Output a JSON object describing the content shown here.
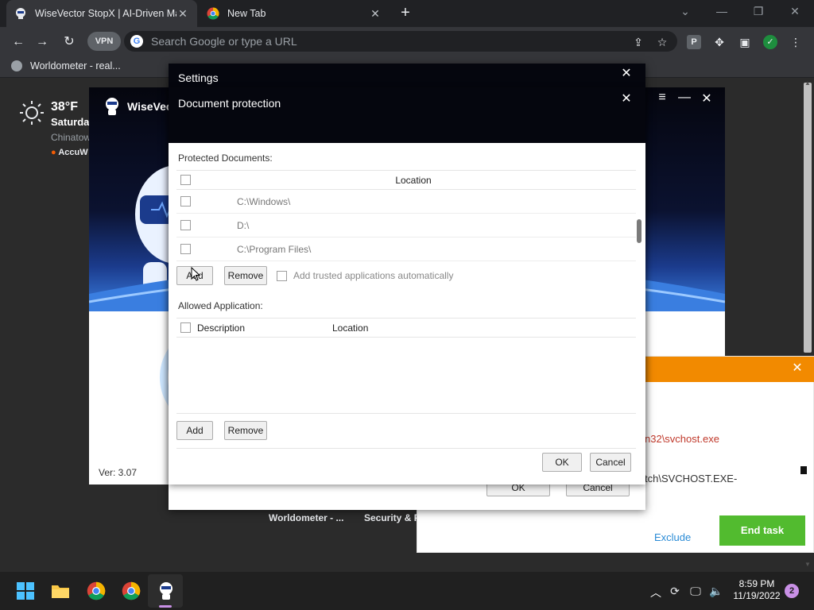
{
  "browser": {
    "tabs": [
      {
        "title": "WiseVector StopX | AI-Driven Ma",
        "active": true
      },
      {
        "title": "New Tab",
        "active": false
      }
    ],
    "address_placeholder": "Search Google or type a URL",
    "vpn_label": "VPN",
    "bookmark": "Worldometer - real...",
    "ext_p": "P"
  },
  "weather": {
    "temp": "38°F",
    "day": "Saturday",
    "location": "Chinatow",
    "source": "AccuW"
  },
  "shortcuts": [
    "Worldometer - ...",
    "Security & P"
  ],
  "wisevector": {
    "title": "WiseVec",
    "version": "Ver: 3.07"
  },
  "alert": {
    "path1": "n32\\svchost.exe",
    "path2": "tch\\SVCHOST.EXE-",
    "exclude": "Exclude",
    "end_task": "End task"
  },
  "settings": {
    "title": "Settings",
    "ok": "OK",
    "cancel": "Cancel"
  },
  "doc_protection": {
    "title": "Document protection",
    "protected_label": "Protected Documents:",
    "location_header": "Location",
    "rows": [
      "C:\\Windows\\",
      "D:\\",
      "C:\\Program Files\\"
    ],
    "add": "Add",
    "remove": "Remove",
    "trusted_label": "Add trusted applications automatically",
    "allowed_label": "Allowed Application:",
    "description_header": "Description",
    "location_header2": "Location",
    "add2": "Add",
    "remove2": "Remove",
    "ok": "OK",
    "cancel": "Cancel"
  },
  "taskbar": {
    "time": "8:59 PM",
    "date": "11/19/2022",
    "notifications": "2"
  }
}
